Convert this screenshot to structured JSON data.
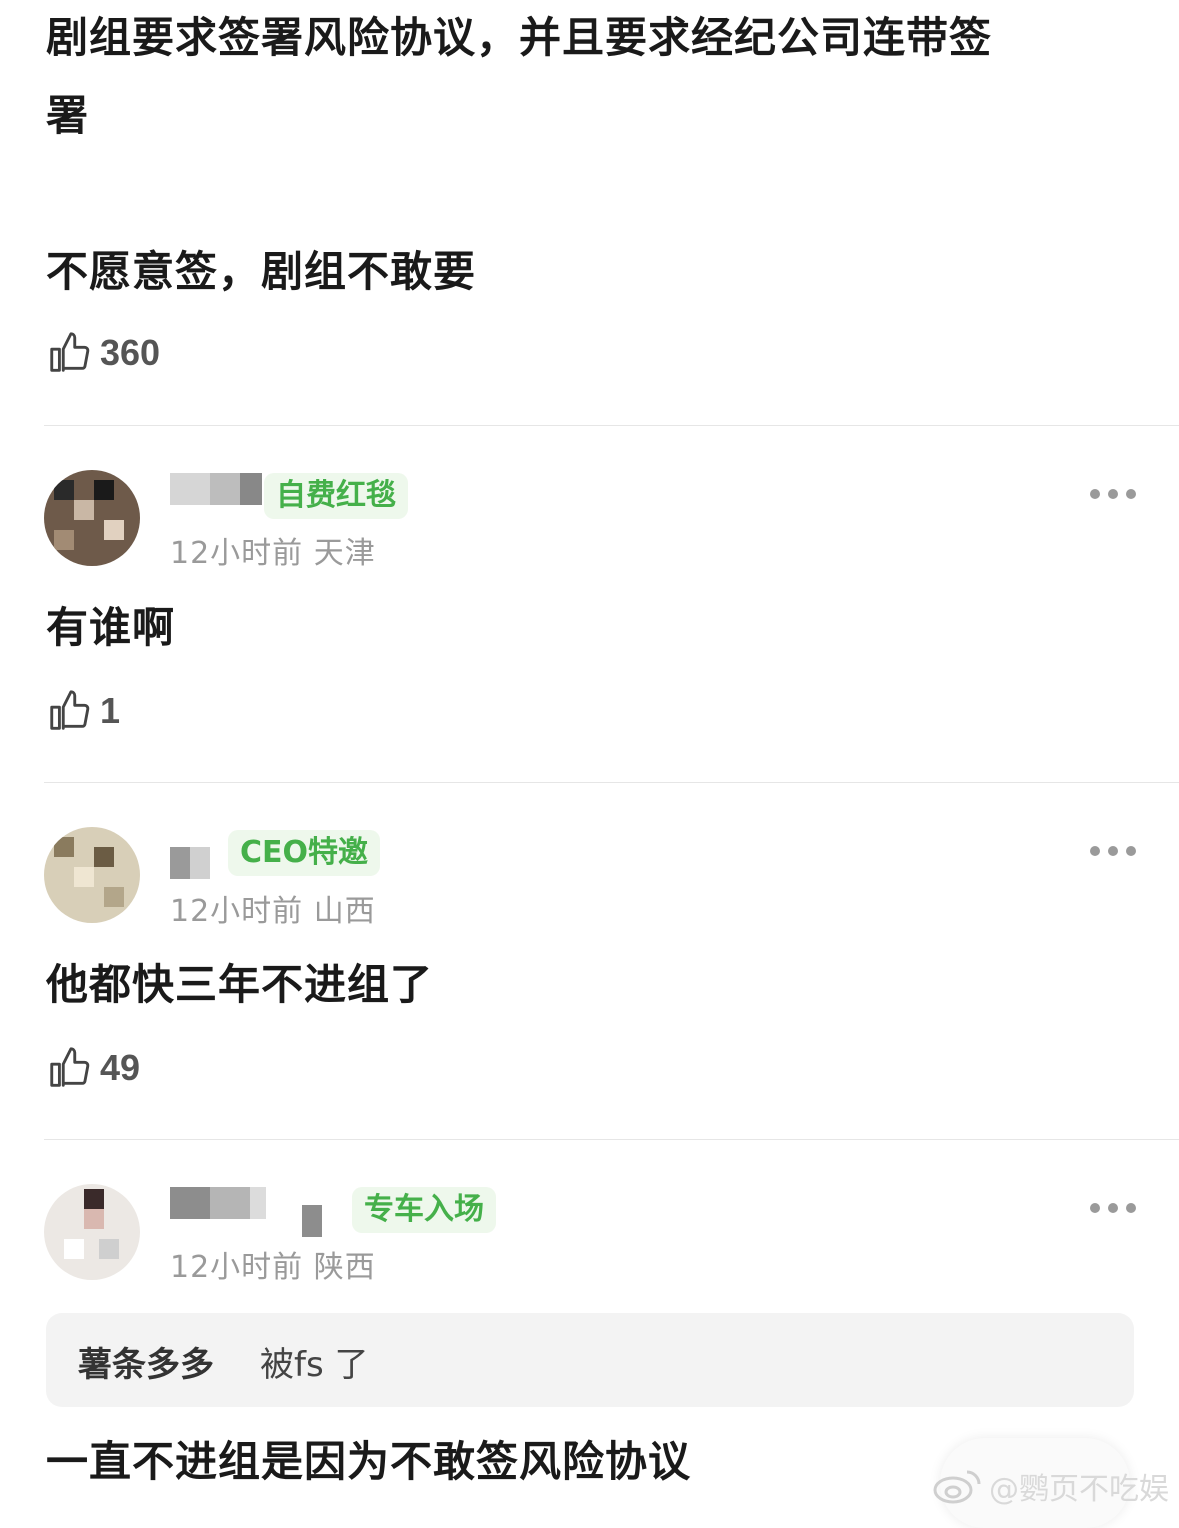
{
  "top_comment": {
    "text_line1": "剧组要求签署风险协议，并且要求经纪公司连带签",
    "text_line2": "署",
    "text_line3": "不愿意签，剧组不敢要",
    "likes": "360"
  },
  "comments": [
    {
      "badge": "自费红毯",
      "meta": "12小时前 天津",
      "text": "有谁啊",
      "likes": "1"
    },
    {
      "badge": "CEO特邀",
      "meta": "12小时前 山西",
      "text": "他都快三年不进组了",
      "likes": "49"
    },
    {
      "badge": "专车入场",
      "meta": "12小时前 陕西",
      "quote_name": "薯条多多",
      "quote_text": "被fs 了",
      "text": "一直不进组是因为不敢签风险协议"
    }
  ],
  "watermark": "@鹦页不吃娱",
  "icons": {
    "like": "thumbs-up-icon",
    "more": "more-horizontal-icon",
    "weibo": "weibo-logo-icon"
  },
  "colors": {
    "badge_bg": "#eef8ec",
    "badge_text": "#45b04a",
    "meta": "#9a9a9a"
  }
}
